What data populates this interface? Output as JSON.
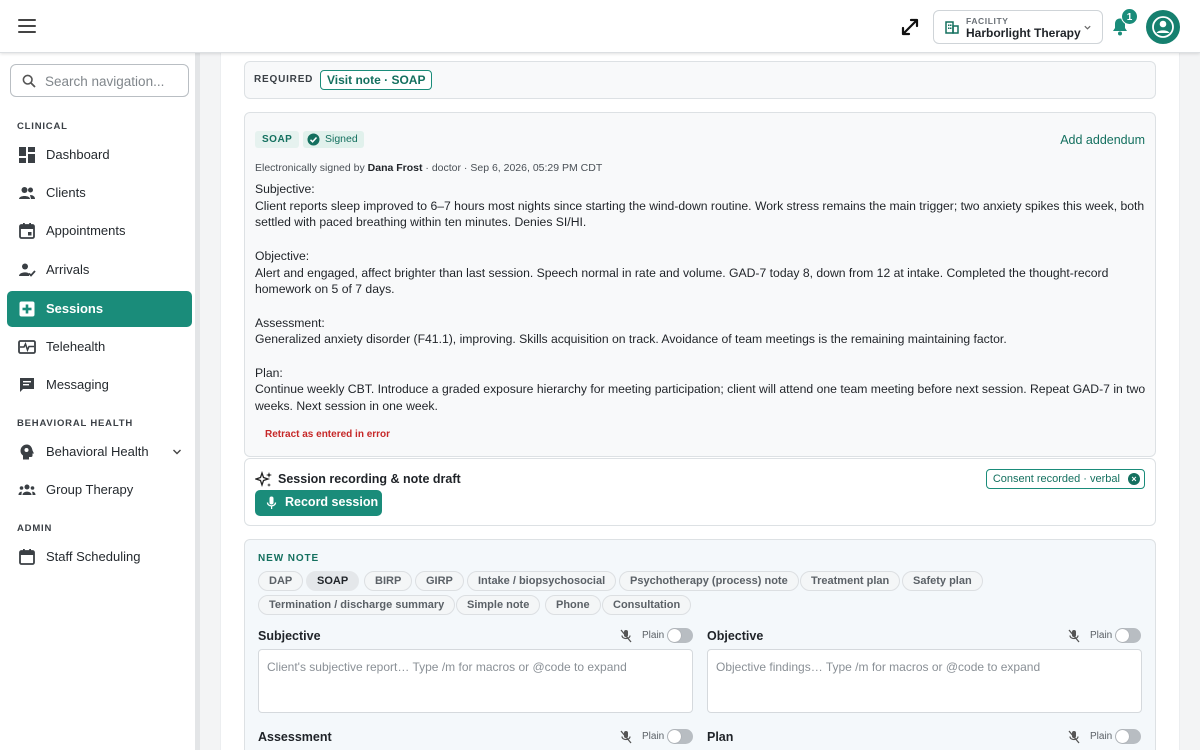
{
  "header": {
    "facility_label": "FACILITY",
    "facility_name": "Harborlight Therapy",
    "notification_count": "1"
  },
  "sidebar": {
    "search_placeholder": "Search navigation...",
    "sections": {
      "clinical": "CLINICAL",
      "behavioral": "BEHAVIORAL HEALTH",
      "admin": "ADMIN"
    },
    "items": [
      {
        "label": "Dashboard",
        "icon": "dashboard-icon"
      },
      {
        "label": "Clients",
        "icon": "people-icon"
      },
      {
        "label": "Appointments",
        "icon": "calendar-icon"
      },
      {
        "label": "Arrivals",
        "icon": "person-check-icon"
      },
      {
        "label": "Sessions",
        "icon": "medical-plus-icon",
        "active": true
      },
      {
        "label": "Telehealth",
        "icon": "monitor-heart-icon"
      },
      {
        "label": "Messaging",
        "icon": "chat-icon"
      },
      {
        "label": "Behavioral Health",
        "icon": "head-icon"
      },
      {
        "label": "Group Therapy",
        "icon": "groups-icon"
      },
      {
        "label": "Staff Scheduling",
        "icon": "calendar-icon"
      }
    ]
  },
  "required": {
    "label": "REQUIRED",
    "chip": "Visit note · SOAP"
  },
  "signed_note": {
    "type_tag": "SOAP",
    "status": "Signed",
    "addendum_link": "Add addendum",
    "esign_prefix": "Electronically signed by",
    "signer": "Dana Frost",
    "esign_suffix": "· doctor · Sep 6, 2026, 05:29 PM CDT",
    "subjective_heading": "Subjective:",
    "subjective": "Client reports sleep improved to 6–7 hours most nights since starting the wind-down routine. Work stress remains the main trigger; two anxiety spikes this week, both settled with paced breathing within ten minutes. Denies SI/HI.",
    "objective_heading": "Objective:",
    "objective": "Alert and engaged, affect brighter than last session. Speech normal in rate and volume. GAD-7 today 8, down from 12 at intake. Completed the thought-record homework on 5 of 7 days.",
    "assessment_heading": "Assessment:",
    "assessment": "Generalized anxiety disorder (F41.1), improving. Skills acquisition on track. Avoidance of team meetings is the remaining maintaining factor.",
    "plan_heading": "Plan:",
    "plan": "Continue weekly CBT. Introduce a graded exposure hierarchy for meeting participation; client will attend one team meeting before next session. Repeat GAD-7 in two weeks. Next session in one week.",
    "retract_link": "Retract as entered in error"
  },
  "recording": {
    "title": "Session recording & note draft",
    "consent_chip": "Consent recorded · verbal",
    "record_button": "Record session"
  },
  "new_note": {
    "title": "NEW NOTE",
    "tabs": [
      "DAP",
      "SOAP",
      "BIRP",
      "GIRP",
      "Intake / biopsychosocial",
      "Psychotherapy (process) note",
      "Treatment plan",
      "Safety plan",
      "Termination / discharge summary",
      "Simple note",
      "Phone",
      "Consultation"
    ],
    "selected_tab": "SOAP",
    "plain_label": "Plain",
    "fields": {
      "subjective": {
        "label": "Subjective",
        "placeholder": "Client's subjective report… Type /m for macros or @code to expand"
      },
      "objective": {
        "label": "Objective",
        "placeholder": "Objective findings… Type /m for macros or @code to expand"
      },
      "assessment": {
        "label": "Assessment"
      },
      "plan": {
        "label": "Plan"
      }
    }
  },
  "colors": {
    "accent": "#1a8c7a",
    "danger": "#c62828"
  }
}
